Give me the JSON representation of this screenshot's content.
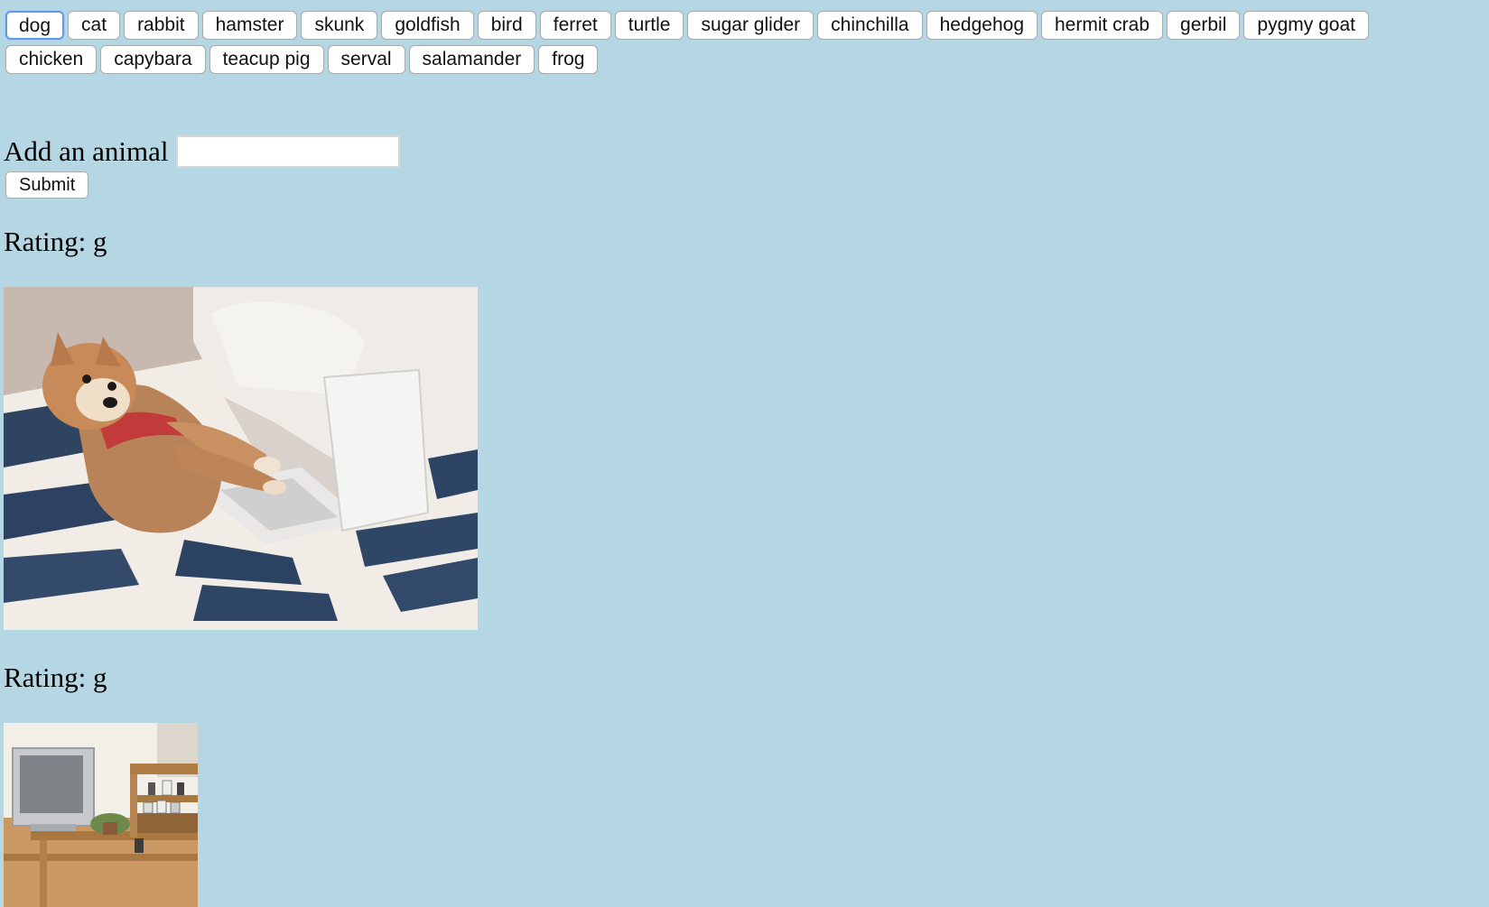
{
  "animals": [
    "dog",
    "cat",
    "rabbit",
    "hamster",
    "skunk",
    "goldfish",
    "bird",
    "ferret",
    "turtle",
    "sugar glider",
    "chinchilla",
    "hedgehog",
    "hermit crab",
    "gerbil",
    "pygmy goat",
    "chicken",
    "capybara",
    "teacup pig",
    "serval",
    "salamander",
    "frog"
  ],
  "selected_animal": "dog",
  "form": {
    "label": "Add an animal",
    "input_value": "",
    "input_placeholder": "",
    "submit_label": "Submit"
  },
  "results": [
    {
      "rating_label": "Rating: g",
      "image_subject": "shiba inu dog lying in bed typing on a laptop"
    },
    {
      "rating_label": "Rating: g",
      "image_subject": "room with a television on a wooden shelf"
    }
  ],
  "colors": {
    "page_background": "#b5d7e4",
    "active_button_border": "#5d9be8"
  }
}
